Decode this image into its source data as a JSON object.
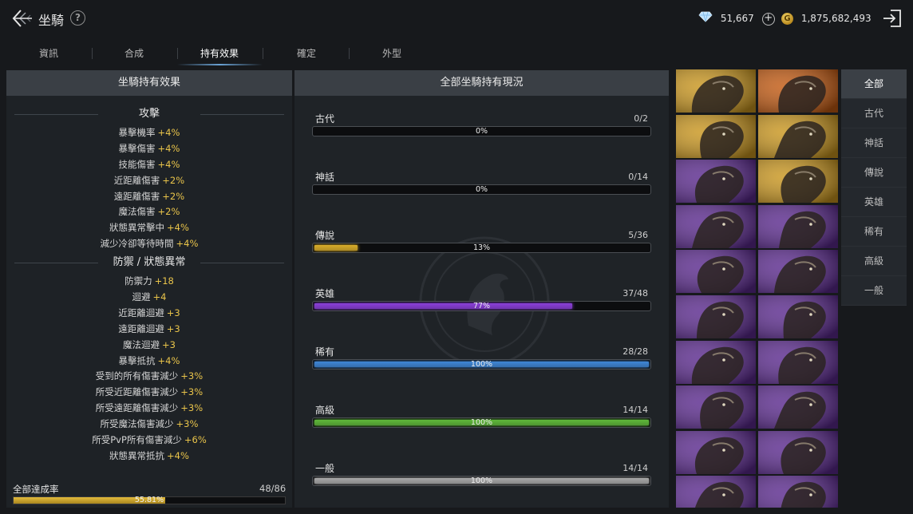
{
  "header": {
    "title": "坐騎",
    "help": "?",
    "diamonds": "51,667",
    "diamond_plus": "+",
    "gold": "1,875,682,493",
    "gold_symbol": "G"
  },
  "tabs": [
    {
      "label": "資訊",
      "active": false
    },
    {
      "label": "合成",
      "active": false
    },
    {
      "label": "持有效果",
      "active": true
    },
    {
      "label": "確定",
      "active": false
    },
    {
      "label": "外型",
      "active": false
    }
  ],
  "left_panel": {
    "title": "坐騎持有效果",
    "attack": {
      "title": "攻擊",
      "effects": [
        {
          "name": "暴擊機率",
          "value": "+4%"
        },
        {
          "name": "暴擊傷害",
          "value": "+4%"
        },
        {
          "name": "技能傷害",
          "value": "+4%"
        },
        {
          "name": "近距離傷害",
          "value": "+2%"
        },
        {
          "name": "遠距離傷害",
          "value": "+2%"
        },
        {
          "name": "魔法傷害",
          "value": "+2%"
        },
        {
          "name": "狀態異常擊中",
          "value": "+4%"
        },
        {
          "name": "減少冷卻等待時間",
          "value": "+4%"
        }
      ]
    },
    "defense": {
      "title": "防禦 / 狀態異常",
      "effects": [
        {
          "name": "防禦力",
          "value": "+18"
        },
        {
          "name": "迴避",
          "value": "+4"
        },
        {
          "name": "近距離迴避",
          "value": "+3"
        },
        {
          "name": "遠距離迴避",
          "value": "+3"
        },
        {
          "name": "魔法迴避",
          "value": "+3"
        },
        {
          "name": "暴擊抵抗",
          "value": "+4%"
        },
        {
          "name": "受到的所有傷害減少",
          "value": "+3%"
        },
        {
          "name": "所受近距離傷害減少",
          "value": "+3%"
        },
        {
          "name": "所受遠距離傷害減少",
          "value": "+3%"
        },
        {
          "name": "所受魔法傷害減少",
          "value": "+3%"
        },
        {
          "name": "所受PvP所有傷害減少",
          "value": "+6%"
        },
        {
          "name": "狀態異常抵抗",
          "value": "+4%"
        }
      ]
    },
    "achievement": {
      "label": "全部達成率",
      "count": "48/86",
      "percent": "55.81%",
      "fraction": 0.5581
    }
  },
  "middle_panel": {
    "title": "全部坐騎持有現況",
    "grades": [
      {
        "name": "古代",
        "count": "0/2",
        "percent": "0%",
        "fraction": 0.0,
        "color": "#9a9a9a"
      },
      {
        "name": "神話",
        "count": "0/14",
        "percent": "0%",
        "fraction": 0.0,
        "color": "#9a9a9a"
      },
      {
        "name": "傳說",
        "count": "5/36",
        "percent": "13%",
        "fraction": 0.13,
        "color": "#d8ac2a"
      },
      {
        "name": "英雄",
        "count": "37/48",
        "percent": "77%",
        "fraction": 0.77,
        "color": "#8a3fd8"
      },
      {
        "name": "稀有",
        "count": "28/28",
        "percent": "100%",
        "fraction": 1.0,
        "color": "#3f86d6"
      },
      {
        "name": "高級",
        "count": "14/14",
        "percent": "100%",
        "fraction": 1.0,
        "color": "#5fb83a"
      },
      {
        "name": "一般",
        "count": "14/14",
        "percent": "100%",
        "fraction": 1.0,
        "color": "#a8a8a8"
      }
    ]
  },
  "mounts": [
    {
      "bg": "#c9961f",
      "creature": "dragon-mount"
    },
    {
      "bg": "#c25a12",
      "creature": "fire-dragon-mount"
    },
    {
      "bg": "#c9961f",
      "creature": "armored-horse-mount"
    },
    {
      "bg": "#c9961f",
      "creature": "wyvern-mount"
    },
    {
      "bg": "#5b2a8e",
      "creature": "armored-beast-mount"
    },
    {
      "bg": "#c9961f",
      "creature": "sea-serpent-mount"
    },
    {
      "bg": "#5b2a8e",
      "creature": "lion-mount"
    },
    {
      "bg": "#5b2a8e",
      "creature": "bird-mount"
    },
    {
      "bg": "#5b2a8e",
      "creature": "rex-mount"
    },
    {
      "bg": "#5b2a8e",
      "creature": "drake-mount"
    },
    {
      "bg": "#5b2a8e",
      "creature": "spider-mount"
    },
    {
      "bg": "#5b2a8e",
      "creature": "raptor-mount"
    },
    {
      "bg": "#5b2a8e",
      "creature": "horned-mount"
    },
    {
      "bg": "#5b2a8e",
      "creature": "griffin-mount"
    },
    {
      "bg": "#5b2a8e",
      "creature": "goat-mount"
    },
    {
      "bg": "#5b2a8e",
      "creature": "serpent-mount"
    },
    {
      "bg": "#5b2a8e",
      "creature": "ram-mount"
    },
    {
      "bg": "#5b2a8e",
      "creature": "horse-mount"
    },
    {
      "bg": "#5b2a8e",
      "creature": "beast-mount"
    },
    {
      "bg": "#5b2a8e",
      "creature": "dragon-mount-2"
    }
  ],
  "filters": [
    {
      "label": "全部",
      "active": true
    },
    {
      "label": "古代",
      "active": false
    },
    {
      "label": "神話",
      "active": false
    },
    {
      "label": "傳說",
      "active": false
    },
    {
      "label": "英雄",
      "active": false
    },
    {
      "label": "稀有",
      "active": false
    },
    {
      "label": "高級",
      "active": false
    },
    {
      "label": "一般",
      "active": false
    }
  ]
}
